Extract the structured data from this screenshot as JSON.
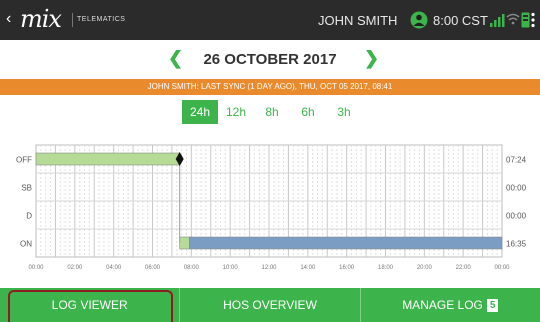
{
  "header": {
    "back_glyph": "‹",
    "logo_text": "mix",
    "logo_sub": "TELEMATICS",
    "user": "JOHN SMITH",
    "time": "8:00 CST"
  },
  "date_nav": {
    "prev_glyph": "❮",
    "date": "26 OCTOBER 2017",
    "next_glyph": "❯"
  },
  "sync_text": "JOHN SMITH: LAST SYNC (1 DAY AGO), THU, OCT 05 2017, 08:41",
  "tabs": [
    {
      "label": "24h",
      "active": true
    },
    {
      "label": "12h",
      "active": false
    },
    {
      "label": "8h",
      "active": false
    },
    {
      "label": "6h",
      "active": false
    },
    {
      "label": "3h",
      "active": false
    }
  ],
  "bottom_nav": {
    "log_viewer": "LOG VIEWER",
    "hos_overview": "HOS OVERVIEW",
    "manage_log": "MANAGE LOG",
    "manage_badge": "5"
  },
  "colors": {
    "accent_green": "#3cb44b",
    "off_duty": "#b5db96",
    "on_duty": "#7b9dc4",
    "sync_orange": "#e98a2c"
  },
  "chart_data": {
    "type": "gantt-timeline",
    "rows": [
      "OFF",
      "SB",
      "D",
      "ON"
    ],
    "row_totals": [
      "07:24",
      "00:00",
      "00:00",
      "16:35"
    ],
    "x_ticks": [
      "00:00",
      "02:00",
      "04:00",
      "06:00",
      "08:00",
      "10:00",
      "12:00",
      "14:00",
      "16:00",
      "18:00",
      "20:00",
      "22:00",
      "00:00"
    ],
    "x_range_hours": [
      0,
      24
    ],
    "segments": [
      {
        "status": "OFF",
        "start_hour": 0,
        "end_hour": 7.4,
        "color": "#b5db96"
      },
      {
        "status": "ON",
        "start_hour": 7.4,
        "end_hour": 7.9,
        "color": "#b5db96"
      },
      {
        "status": "ON",
        "start_hour": 7.9,
        "end_hour": 24,
        "color": "#7b9dc4"
      }
    ],
    "marker_hour": 7.4,
    "grid": true
  }
}
